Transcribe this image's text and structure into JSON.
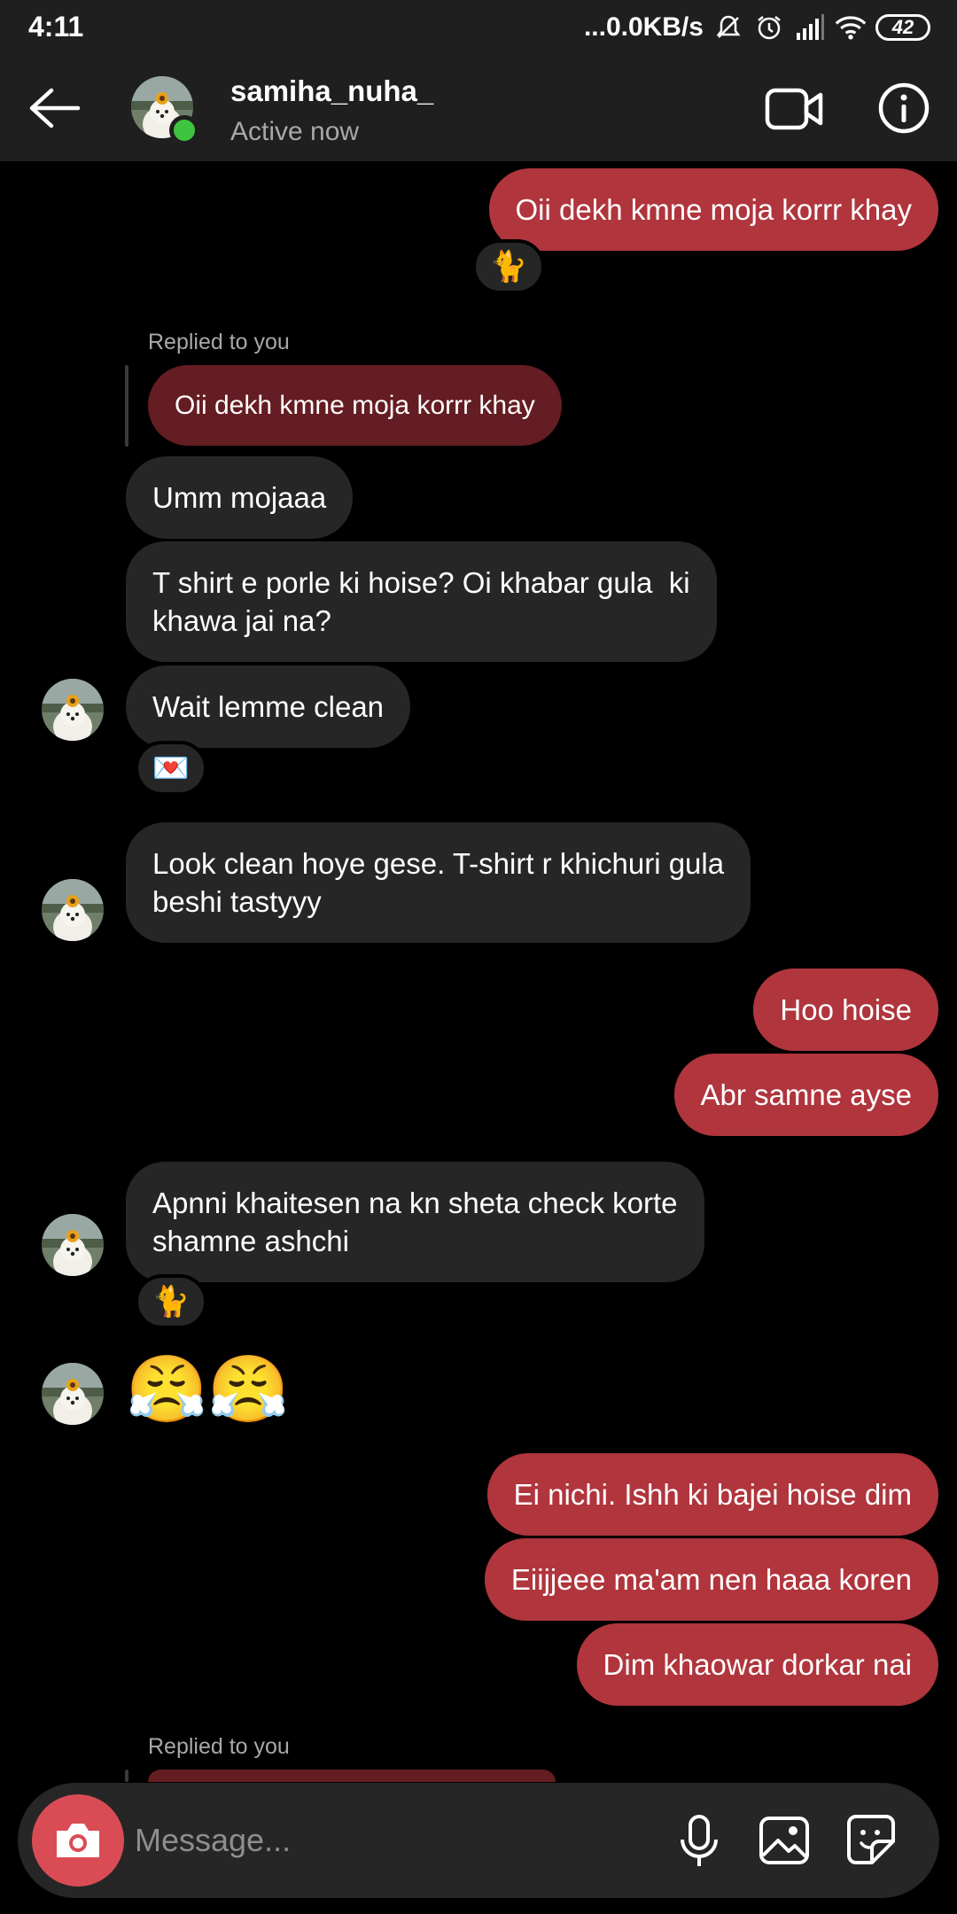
{
  "status_bar": {
    "time": "4:11",
    "network_speed": "...0.0KB/s",
    "battery": "42",
    "icons": [
      "mute-icon",
      "alarm-icon",
      "signal-icon",
      "wifi-icon",
      "battery-icon"
    ]
  },
  "header": {
    "username": "samiha_nuha_",
    "status": "Active now",
    "icons": [
      "back-arrow-icon",
      "video-call-icon",
      "info-icon"
    ]
  },
  "conversation": {
    "replied_label": "Replied to you",
    "messages": [
      {
        "dir": "out",
        "text": "Oii dekh kmne moja korrr khay",
        "reaction": "🐈"
      },
      {
        "dir": "in",
        "quoted": "Oii dekh kmne moja korrr khay",
        "text": "Umm mojaaa"
      },
      {
        "dir": "in",
        "text": "T shirt e porle ki hoise? Oi khabar gula  ki\nkhawa jai na?"
      },
      {
        "dir": "in",
        "text": "Wait lemme clean",
        "reaction": "💌"
      },
      {
        "dir": "in",
        "text": "Look clean hoye gese. T-shirt r khichuri gula\nbeshi tastyyy"
      },
      {
        "dir": "out",
        "text": "Hoo hoise"
      },
      {
        "dir": "out",
        "text": "Abr samne ayse"
      },
      {
        "dir": "in",
        "text": "Apnni khaitesen na kn sheta check korte\nshamne ashchi",
        "reaction": "🐈"
      },
      {
        "dir": "in",
        "text": "😤😤"
      },
      {
        "dir": "out",
        "text": "Ei nichi. Ishh ki bajei hoise dim"
      },
      {
        "dir": "out",
        "text": "Eiijjeee ma'am nen haaa koren"
      },
      {
        "dir": "out",
        "text": "Dim khaowar dorkar nai"
      }
    ]
  },
  "composer": {
    "placeholder": "Message...",
    "icons": [
      "camera-icon",
      "microphone-icon",
      "gallery-icon",
      "sticker-icon"
    ]
  },
  "colors": {
    "outgoing_bubble": "#b0353d",
    "incoming_bubble": "#262626",
    "quoted_bubble": "#641d22",
    "camera_button": "#d94c55",
    "online_dot": "#3fc43f"
  }
}
